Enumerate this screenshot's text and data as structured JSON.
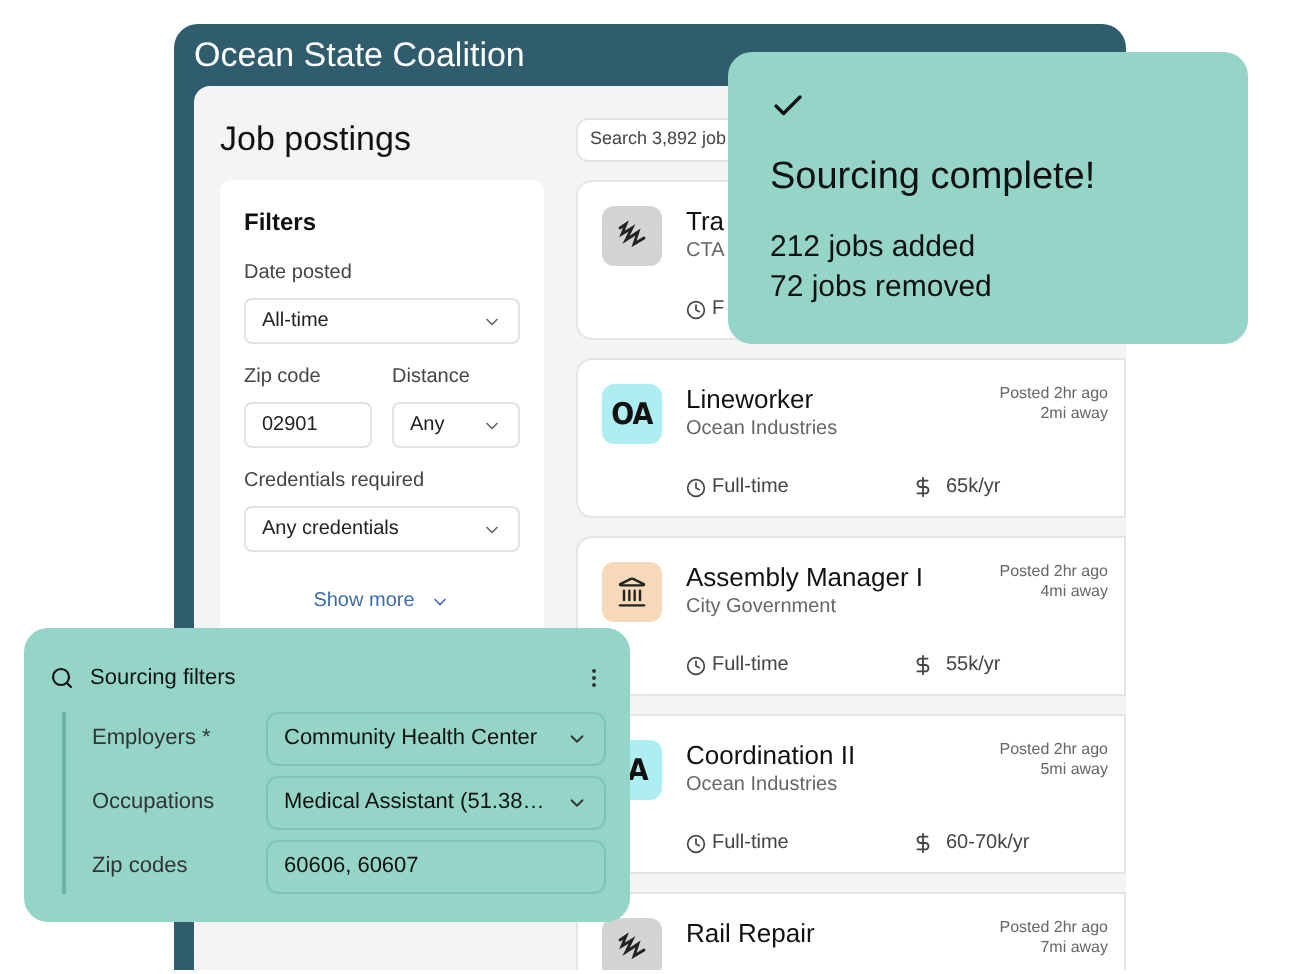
{
  "window": {
    "title": "Ocean State Coalition"
  },
  "page_title": "Job postings",
  "filters": {
    "title": "Filters",
    "rows": [
      [
        {
          "label": "Date posted",
          "value": "All-time",
          "kind": "select"
        }
      ],
      [
        {
          "label": "Zip code",
          "value": "02901",
          "kind": "text"
        },
        {
          "label": "Distance",
          "value": "Any",
          "kind": "select"
        }
      ],
      [
        {
          "label": "Credentials required",
          "value": "Any credentials",
          "kind": "select"
        }
      ]
    ],
    "show_more": "Show more"
  },
  "search": {
    "placeholder": "Search 3,892 job"
  },
  "jobs": [
    {
      "logo": {
        "kind": "squiggle",
        "color": "#d4d4d4"
      },
      "title": "Tra",
      "company": "CTA",
      "type": "F"
    },
    {
      "logo": {
        "kind": "text",
        "text": "OA",
        "color": "#aeeef2"
      },
      "title": "Lineworker",
      "company": "Ocean Industries",
      "posted": "Posted 2hr ago",
      "distance": "2mi away",
      "type": "Full-time",
      "salary": "65k/yr"
    },
    {
      "logo": {
        "kind": "building",
        "color": "#f5d9b8"
      },
      "title": "Assembly Manager I",
      "company": "City Government",
      "posted": "Posted 2hr ago",
      "distance": "4mi away",
      "type": "Full-time",
      "salary": "55k/yr"
    },
    {
      "logo": {
        "kind": "text",
        "text": "A",
        "color": "#aeeef2"
      },
      "title": "Coordination II",
      "company": "Ocean Industries",
      "posted": "Posted 2hr ago",
      "distance": "5mi away",
      "type": "Full-time",
      "salary": "60-70k/yr"
    },
    {
      "logo": {
        "kind": "squiggle",
        "color": "#d4d4d4"
      },
      "title": "Rail Repair",
      "posted": "Posted 2hr ago",
      "distance": "7mi away"
    }
  ],
  "toast": {
    "title": "Sourcing complete!",
    "lines": [
      "212 jobs added",
      "72 jobs removed"
    ]
  },
  "sourcing": {
    "title": "Sourcing filters",
    "fields": [
      {
        "label": "Employers *",
        "value": "Community Health Center",
        "kind": "select"
      },
      {
        "label": "Occupations",
        "value": "Medical Assistant (51.38…",
        "kind": "select"
      },
      {
        "label": "Zip codes",
        "value": "60606, 60607",
        "kind": "text"
      }
    ]
  }
}
